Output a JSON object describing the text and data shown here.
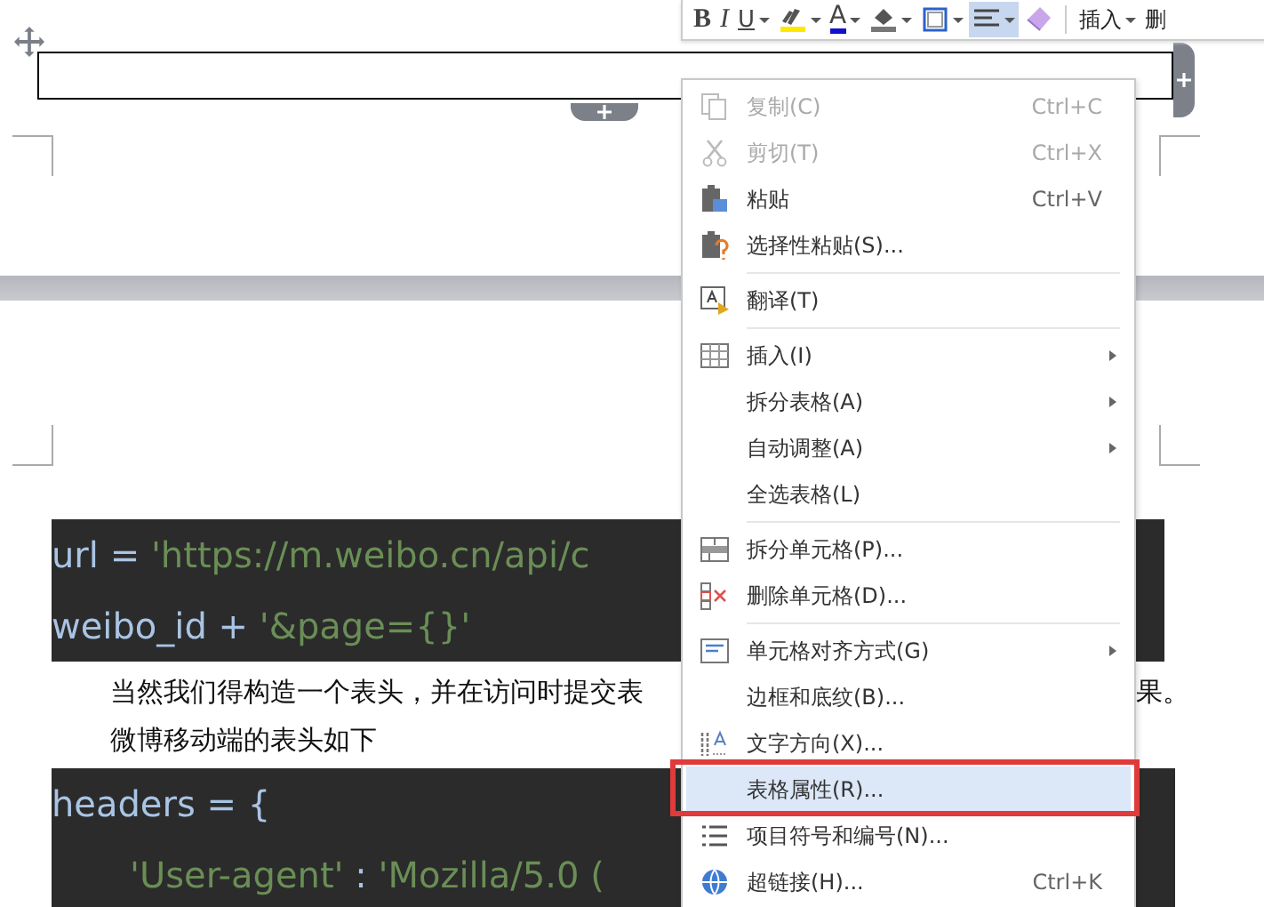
{
  "toolbar": {
    "buttons": [
      {
        "kind": "bold",
        "label": "B",
        "dropdown": false,
        "selected": false
      },
      {
        "kind": "italic",
        "label": "I",
        "dropdown": false,
        "selected": false
      },
      {
        "kind": "underline",
        "label": "U",
        "dropdown": true,
        "selected": false
      },
      {
        "kind": "highlight",
        "dropdown": true,
        "selected": false
      },
      {
        "kind": "font-color",
        "label": "A",
        "dropdown": true,
        "selected": false
      },
      {
        "kind": "fill",
        "dropdown": true,
        "selected": false
      },
      {
        "kind": "border",
        "dropdown": true,
        "selected": false
      },
      {
        "kind": "align",
        "dropdown": true,
        "selected": true
      },
      {
        "kind": "eraser",
        "dropdown": false,
        "selected": false
      },
      {
        "kind": "text",
        "label": "插入",
        "dropdown": true,
        "selected": false
      },
      {
        "kind": "text",
        "label": "删",
        "dropdown": false,
        "selected": false
      }
    ]
  },
  "document": {
    "code_block_1": [
      {
        "indented": false,
        "tokens": [
          {
            "kind": "plain",
            "text": "url = "
          },
          {
            "kind": "string",
            "text": "'https://m.weibo.cn/api/c"
          }
        ]
      },
      {
        "indented": false,
        "tokens": [
          {
            "kind": "plain",
            "text": "weibo_id + "
          },
          {
            "kind": "string",
            "text": "'&page={}'"
          }
        ]
      }
    ],
    "paragraph": [
      "当然我们得构造一个表头，并在访问时提交表",
      "微博移动端的表头如下"
    ],
    "paragraph_tail": "果。",
    "code_block_2": [
      {
        "indented": false,
        "tokens": [
          {
            "kind": "plain",
            "text": "headers = {"
          }
        ]
      },
      {
        "indented": true,
        "tokens": [
          {
            "kind": "string",
            "text": "'User-agent'"
          },
          {
            "kind": "plain",
            "text": " : "
          },
          {
            "kind": "string",
            "text": "'Mozilla/5.0 ("
          }
        ]
      }
    ]
  },
  "context_menu": [
    {
      "kind": "item",
      "label": "复制(C)",
      "shortcut": "Ctrl+C",
      "disabled": true,
      "submenu": false,
      "selected": false,
      "annotated": false
    },
    {
      "kind": "item",
      "label": "剪切(T)",
      "shortcut": "Ctrl+X",
      "disabled": true,
      "submenu": false,
      "selected": false,
      "annotated": false
    },
    {
      "kind": "item",
      "label": "粘贴",
      "shortcut": "Ctrl+V",
      "disabled": false,
      "submenu": false,
      "selected": false,
      "annotated": false
    },
    {
      "kind": "item",
      "label": "选择性粘贴(S)...",
      "disabled": false,
      "submenu": false,
      "selected": false,
      "annotated": false
    },
    {
      "kind": "separator"
    },
    {
      "kind": "item",
      "label": "翻译(T)",
      "disabled": false,
      "submenu": false,
      "selected": false,
      "annotated": false
    },
    {
      "kind": "separator"
    },
    {
      "kind": "item",
      "label": "插入(I)",
      "disabled": false,
      "submenu": true,
      "selected": false,
      "annotated": false
    },
    {
      "kind": "item",
      "label": "拆分表格(A)",
      "disabled": false,
      "submenu": true,
      "selected": false,
      "annotated": false
    },
    {
      "kind": "item",
      "label": "自动调整(A)",
      "disabled": false,
      "submenu": true,
      "selected": false,
      "annotated": false
    },
    {
      "kind": "item",
      "label": "全选表格(L)",
      "disabled": false,
      "submenu": false,
      "selected": false,
      "annotated": false
    },
    {
      "kind": "separator"
    },
    {
      "kind": "item",
      "label": "拆分单元格(P)...",
      "disabled": false,
      "submenu": false,
      "selected": false,
      "annotated": false
    },
    {
      "kind": "item",
      "label": "删除单元格(D)...",
      "disabled": false,
      "submenu": false,
      "selected": false,
      "annotated": false
    },
    {
      "kind": "separator"
    },
    {
      "kind": "item",
      "label": "单元格对齐方式(G)",
      "disabled": false,
      "submenu": true,
      "selected": false,
      "annotated": false
    },
    {
      "kind": "item",
      "label": "边框和底纹(B)...",
      "disabled": false,
      "submenu": false,
      "selected": false,
      "annotated": false
    },
    {
      "kind": "item",
      "label": "文字方向(X)...",
      "disabled": false,
      "submenu": false,
      "selected": false,
      "annotated": false
    },
    {
      "kind": "item",
      "label": "表格属性(R)...",
      "disabled": false,
      "submenu": false,
      "selected": true,
      "annotated": true
    },
    {
      "kind": "item",
      "label": "项目符号和编号(N)...",
      "disabled": false,
      "submenu": false,
      "selected": false,
      "annotated": false
    },
    {
      "kind": "item",
      "label": "超链接(H)...",
      "shortcut": "Ctrl+K",
      "disabled": false,
      "submenu": false,
      "selected": false,
      "annotated": false
    }
  ]
}
